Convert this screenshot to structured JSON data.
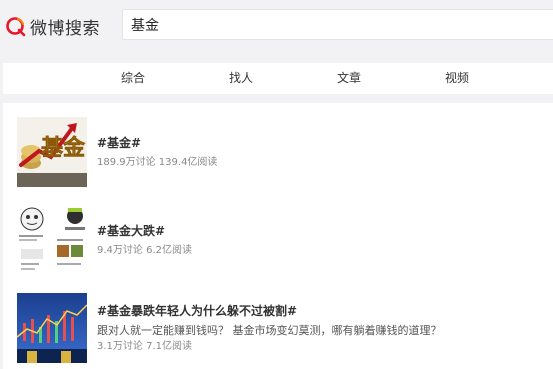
{
  "header": {
    "logo_text": "微博搜索",
    "search_value": "基金"
  },
  "tabs": [
    {
      "label": "综合"
    },
    {
      "label": "找人"
    },
    {
      "label": "文章"
    },
    {
      "label": "视频"
    }
  ],
  "results": [
    {
      "title": "#基金#",
      "stats": "189.9万讨论 139.4亿阅读",
      "thumb_text": "基金"
    },
    {
      "title": "#基金大跌#",
      "stats": "9.4万讨论 6.2亿阅读"
    },
    {
      "title": "#基金暴跌年轻人为什么躲不过被割#",
      "desc": "跟对人就一定能赚到钱吗？ 基金市场变幻莫测，哪有躺着赚钱的道理？",
      "stats": "3.1万讨论 7.1亿阅读"
    }
  ],
  "colors": {
    "brand": "#ff8200",
    "logo_red": "#e6162d",
    "background": "#f2f2f5"
  }
}
